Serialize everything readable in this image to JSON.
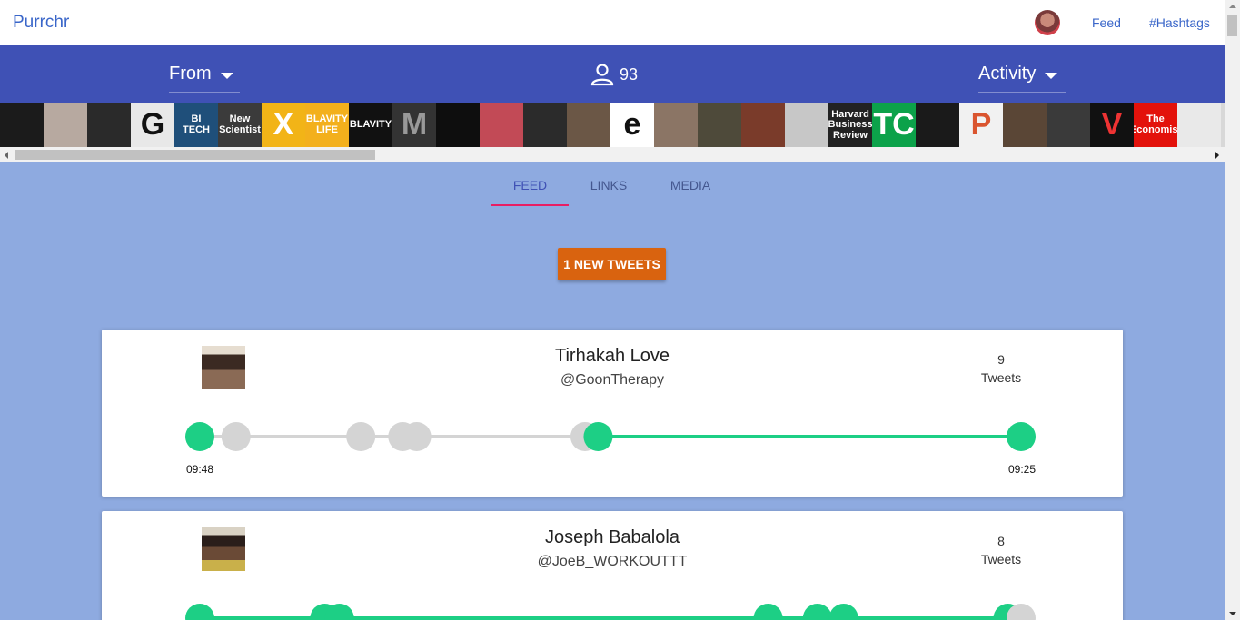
{
  "app": {
    "brand": "Purrchr"
  },
  "nav": {
    "feed": "Feed",
    "hashtags": "#Hashtags"
  },
  "filters": {
    "from_label": "From",
    "activity_label": "Activity",
    "user_count": "93"
  },
  "strip": [
    {
      "bg": "#1b1b1b"
    },
    {
      "bg": "#b7a9a0"
    },
    {
      "bg": "#2a2a2a"
    },
    {
      "bg": "#e8e8e8",
      "text": "G",
      "fg": "#111"
    },
    {
      "bg": "#1f4f7a",
      "text": "BI\nTECH",
      "fg": "#fff"
    },
    {
      "bg": "#3b3b3b",
      "text": "New\nScientist",
      "fg": "#fff"
    },
    {
      "bg": "#f2b417",
      "text": "X",
      "fg": "#fff"
    },
    {
      "bg": "#f3b01c",
      "text": "BLAVITY\nLIFE",
      "fg": "#fff"
    },
    {
      "bg": "#111",
      "text": "BLAVITY",
      "fg": "#fff"
    },
    {
      "bg": "#333",
      "text": "M",
      "fg": "#999"
    },
    {
      "bg": "#0e0e0e"
    },
    {
      "bg": "#c24a56"
    },
    {
      "bg": "#2b2b2b"
    },
    {
      "bg": "#6b5746"
    },
    {
      "bg": "#fff",
      "text": "e",
      "fg": "#111"
    },
    {
      "bg": "#8b7565"
    },
    {
      "bg": "#4e4a3a"
    },
    {
      "bg": "#7a3b2a"
    },
    {
      "bg": "#c7c7c7"
    },
    {
      "bg": "#222",
      "text": "Harvard\nBusiness\nReview",
      "fg": "#fff"
    },
    {
      "bg": "#0ca24a",
      "text": "TC",
      "fg": "#fff"
    },
    {
      "bg": "#1a1a1a"
    },
    {
      "bg": "#f1f1f1",
      "text": "P",
      "fg": "#da552f"
    },
    {
      "bg": "#5a4636"
    },
    {
      "bg": "#3a3a3a"
    },
    {
      "bg": "#111",
      "text": "V",
      "fg": "#e33"
    },
    {
      "bg": "#e3120b",
      "text": "The\nEconomist",
      "fg": "#fff"
    },
    {
      "bg": "#e9e9e9"
    },
    {
      "bg": "#d8d8d8"
    }
  ],
  "tabs": [
    {
      "label": "FEED",
      "active": true
    },
    {
      "label": "LINKS",
      "active": false
    },
    {
      "label": "MEDIA",
      "active": false
    }
  ],
  "new_tweets_button": "1 NEW TWEETS",
  "colors": {
    "green": "#1dcf85",
    "gray": "#d4d4d4",
    "indigo": "#3f51b5",
    "orange": "#d9630f"
  },
  "cards": [
    {
      "name": "Tirhakah Love",
      "handle": "@GoonTherapy",
      "tweet_count": "9",
      "tweets_label": "Tweets",
      "start_time": "09:48",
      "end_time": "09:25",
      "dots": [
        {
          "t": 0.0,
          "green": true
        },
        {
          "t": 0.044,
          "green": false
        },
        {
          "t": 0.196,
          "green": false
        },
        {
          "t": 0.247,
          "green": false
        },
        {
          "t": 0.264,
          "green": false
        },
        {
          "t": 0.469,
          "green": false
        },
        {
          "t": 0.485,
          "green": true
        },
        {
          "t": 1.0,
          "green": true
        }
      ],
      "green_from": 0.485
    },
    {
      "name": "Joseph Babalola",
      "handle": "@JoeB_WORKOUTTT",
      "tweet_count": "8",
      "tweets_label": "Tweets",
      "dots": [
        {
          "t": 0.0,
          "green": true
        },
        {
          "t": 0.152,
          "green": true
        },
        {
          "t": 0.17,
          "green": true
        },
        {
          "t": 0.692,
          "green": true
        },
        {
          "t": 0.752,
          "green": true
        },
        {
          "t": 0.784,
          "green": true
        },
        {
          "t": 0.984,
          "green": true
        },
        {
          "t": 1.0,
          "green": false
        }
      ],
      "green_from": 0.0
    }
  ]
}
